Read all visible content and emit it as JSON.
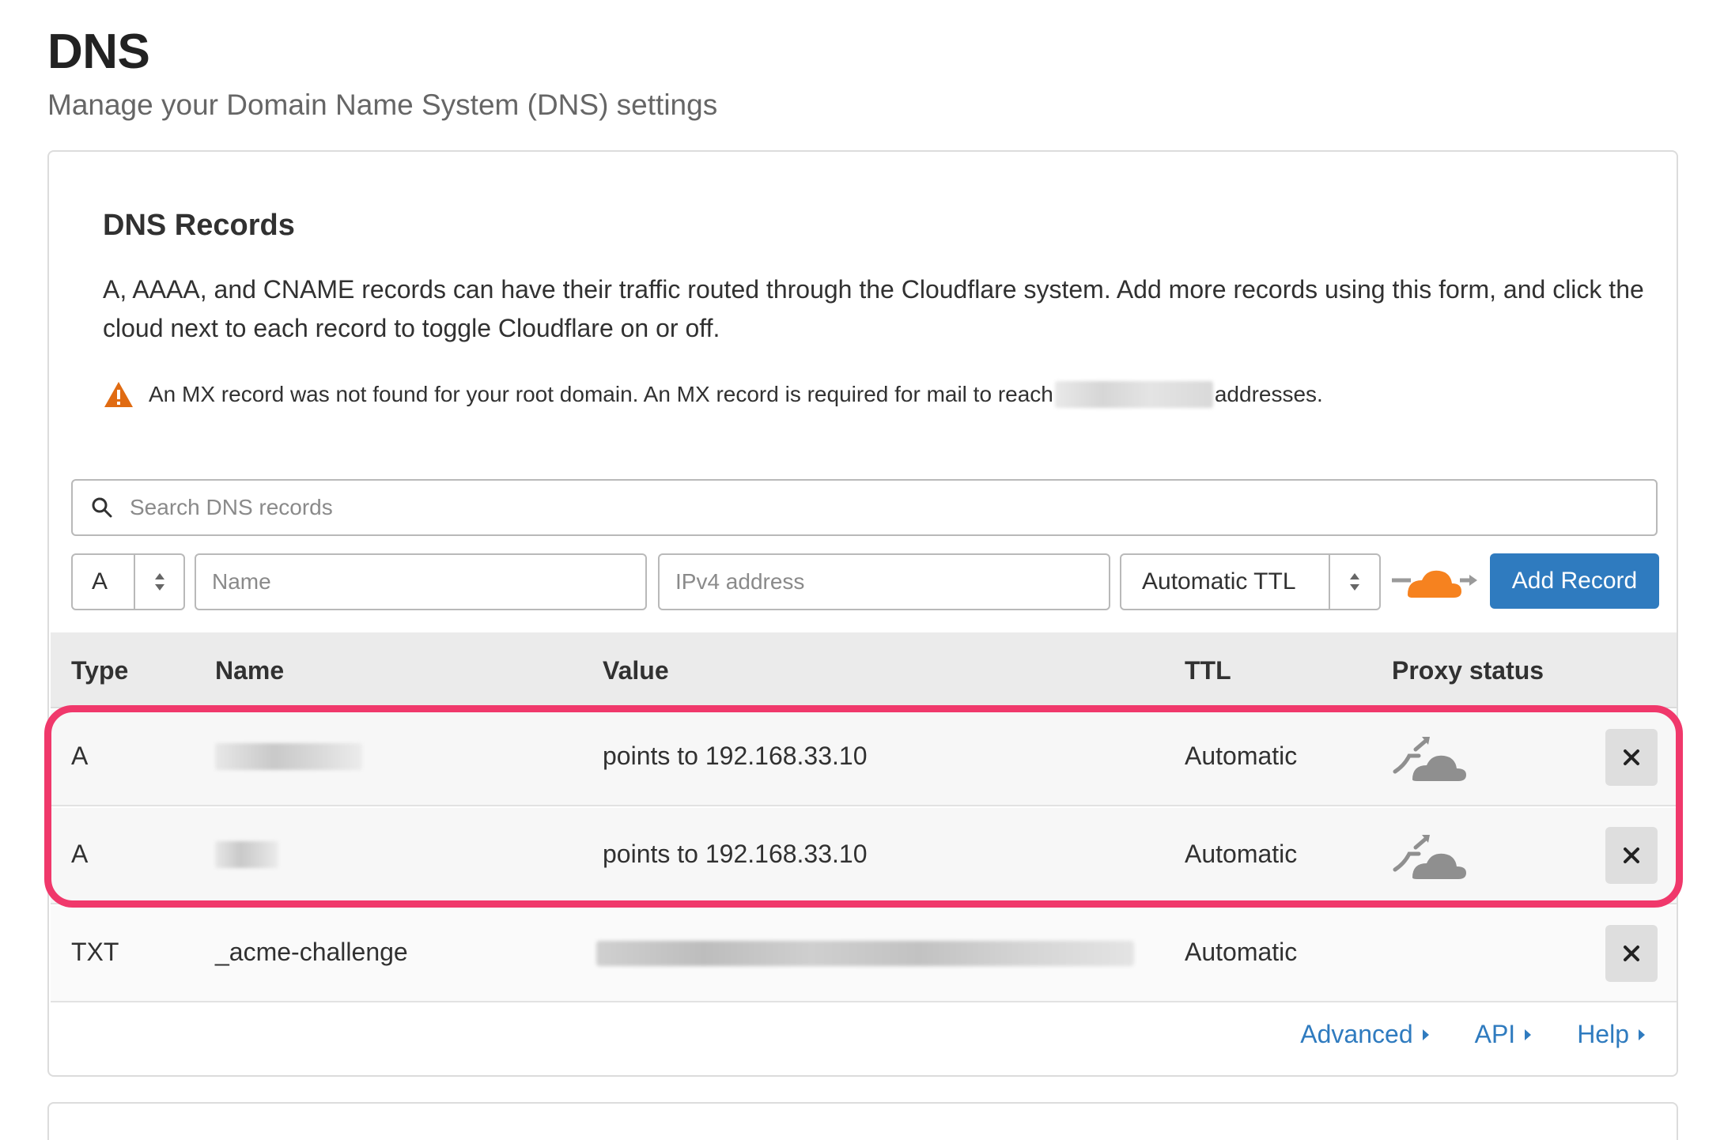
{
  "page": {
    "title": "DNS",
    "subtitle": "Manage your Domain Name System (DNS) settings"
  },
  "card": {
    "title": "DNS Records",
    "description": "A, AAAA, and CNAME records can have their traffic routed through the Cloudflare system. Add more records using this form, and click the cloud next to each record to toggle Cloudflare on or off.",
    "warning_before": "An MX record was not found for your root domain. An MX record is required for mail to reach",
    "warning_after": "addresses."
  },
  "search": {
    "placeholder": "Search DNS records"
  },
  "form": {
    "type_value": "A",
    "name_placeholder": "Name",
    "ip_placeholder": "IPv4 address",
    "ttl_value": "Automatic TTL",
    "add_button": "Add Record"
  },
  "table": {
    "headers": {
      "type": "Type",
      "name": "Name",
      "value": "Value",
      "ttl": "TTL",
      "proxy": "Proxy status"
    },
    "rows": [
      {
        "type": "A",
        "value": "points to 192.168.33.10",
        "ttl": "Automatic"
      },
      {
        "type": "A",
        "value": "points to 192.168.33.10",
        "ttl": "Automatic"
      },
      {
        "type": "TXT",
        "name": "_acme-challenge",
        "ttl": "Automatic"
      }
    ]
  },
  "footer": {
    "advanced": "Advanced",
    "api": "API",
    "help": "Help"
  },
  "colors": {
    "accent_blue": "#2f7bbf",
    "highlight_pink": "#f0386b",
    "cloud_orange": "#f6821f",
    "warning_orange": "#e06b12"
  }
}
